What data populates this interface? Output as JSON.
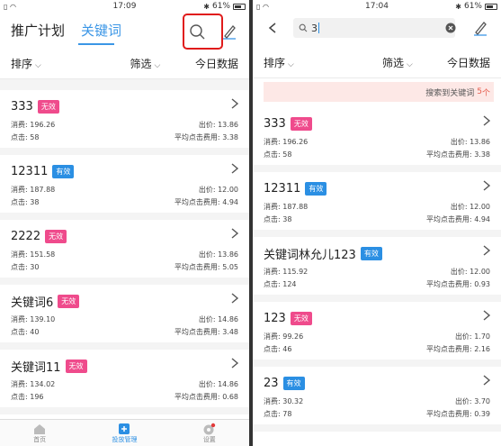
{
  "left": {
    "status": {
      "time": "17:09",
      "battery": "61%"
    },
    "tabs": [
      "推广计划",
      "关键词"
    ],
    "filters": {
      "sort": "排序",
      "filter": "筛选",
      "today": "今日数据"
    },
    "labels": {
      "spend": "消费:",
      "clicks": "点击:",
      "bid": "出价:",
      "avg_cpc": "平均点击费用:"
    },
    "items": [
      {
        "keyword": "333",
        "status": "无效",
        "spend": "196.26",
        "clicks": "58",
        "bid": "13.86",
        "avg": "3.38"
      },
      {
        "keyword": "12311",
        "status": "有效",
        "spend": "187.88",
        "clicks": "38",
        "bid": "12.00",
        "avg": "4.94"
      },
      {
        "keyword": "2222",
        "status": "无效",
        "spend": "151.58",
        "clicks": "30",
        "bid": "13.86",
        "avg": "5.05"
      },
      {
        "keyword": "关键词6",
        "status": "无效",
        "spend": "139.10",
        "clicks": "40",
        "bid": "14.86",
        "avg": "3.48"
      },
      {
        "keyword": "关键词11",
        "status": "无效",
        "spend": "134.02",
        "clicks": "196",
        "bid": "14.86",
        "avg": "0.68"
      }
    ],
    "tabbar": [
      "首页",
      "投放管理",
      "设置"
    ]
  },
  "right": {
    "status": {
      "time": "17:04",
      "battery": "61%"
    },
    "search": {
      "value": "3"
    },
    "filters": {
      "sort": "排序",
      "filter": "筛选",
      "today": "今日数据"
    },
    "found": {
      "text": "搜索到关键词",
      "count": "5",
      "unit": "个"
    },
    "labels": {
      "spend": "消费:",
      "clicks": "点击:",
      "bid": "出价:",
      "avg_cpc": "平均点击费用:"
    },
    "items": [
      {
        "keyword": "333",
        "status": "无效",
        "spend": "196.26",
        "clicks": "58",
        "bid": "13.86",
        "avg": "3.38"
      },
      {
        "keyword": "12311",
        "status": "有效",
        "spend": "187.88",
        "clicks": "38",
        "bid": "12.00",
        "avg": "4.94"
      },
      {
        "keyword": "关键词林允儿123",
        "status": "有效",
        "spend": "115.92",
        "clicks": "124",
        "bid": "12.00",
        "avg": "0.93"
      },
      {
        "keyword": "123",
        "status": "无效",
        "spend": "99.26",
        "clicks": "46",
        "bid": "1.70",
        "avg": "2.16"
      },
      {
        "keyword": "23",
        "status": "有效",
        "spend": "30.32",
        "clicks": "78",
        "bid": "3.70",
        "avg": "0.39"
      }
    ]
  },
  "colors": {
    "accent": "#3b96e6",
    "invalid_badge": "#ef4b8c",
    "valid_badge": "#2b8fe3",
    "highlight": "#e01b1b"
  }
}
